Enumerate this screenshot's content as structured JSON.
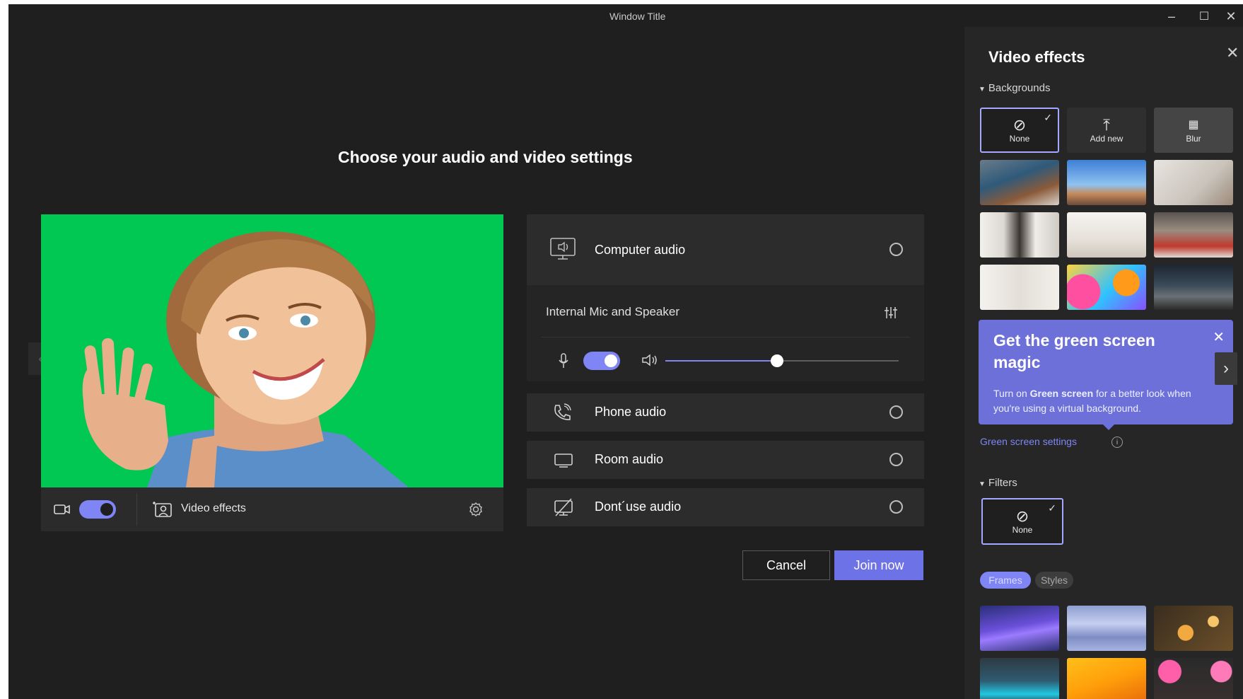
{
  "window": {
    "title": "Window Title"
  },
  "main": {
    "heading": "Choose your audio and video settings"
  },
  "video_toolbar": {
    "effects_label": "Video effects"
  },
  "audio": {
    "computer_audio": "Computer audio",
    "device_name": "Internal Mic and Speaker",
    "volume_level": 0.48,
    "options": [
      {
        "label": "Phone audio",
        "icon": "phone-icon"
      },
      {
        "label": "Room audio",
        "icon": "monitor-icon"
      },
      {
        "label": "Dont´use audio",
        "icon": "no-audio-icon"
      }
    ]
  },
  "actions": {
    "cancel": "Cancel",
    "join": "Join now"
  },
  "effects_panel": {
    "title": "Video effects",
    "backgrounds_header": "Backgrounds",
    "bg_none": "None",
    "bg_add_new": "Add new",
    "bg_blur": "Blur",
    "promo_title": "Get the green screen magic",
    "promo_body_pre": "Turn on ",
    "promo_body_bold": "Green screen",
    "promo_body_post": " for a better look when you're using a virtual background.",
    "green_screen_link": "Green screen settings",
    "filters_header": "Filters",
    "filter_none": "None",
    "tab_frames": "Frames",
    "tab_styles": "Styles"
  },
  "colors": {
    "accent": "#7f85f5",
    "green_screen": "#00c853",
    "panel_bg": "#262626",
    "window_bg": "#1f1f1f"
  }
}
